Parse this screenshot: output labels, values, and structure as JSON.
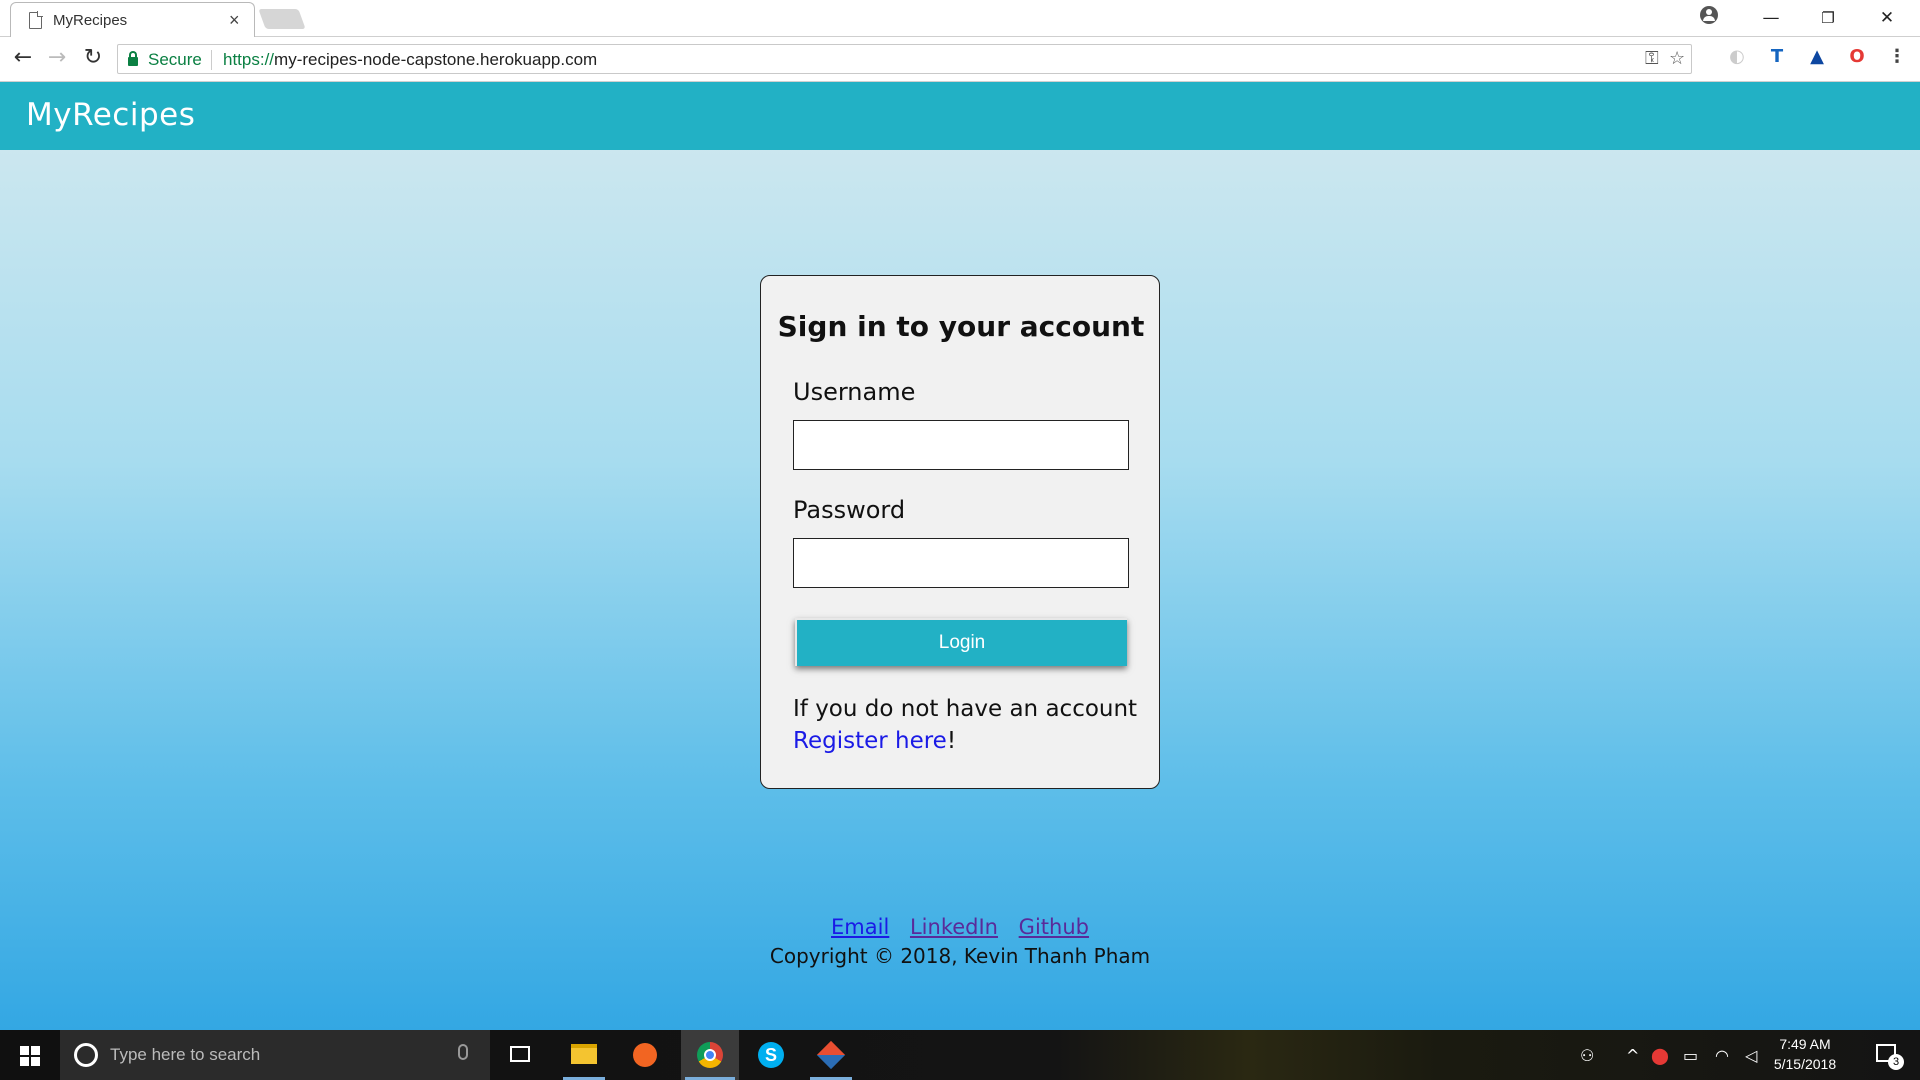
{
  "browser": {
    "tab_title": "MyRecipes",
    "tab_close": "×",
    "secure_label": "Secure",
    "url_scheme": "https://",
    "url_host": "my-recipes-node-capstone.herokuapp.com",
    "back_glyph": "←",
    "forward_glyph": "→",
    "reload_glyph": "↻",
    "minimize_glyph": "—",
    "restore_glyph": "❐",
    "close_glyph": "✕",
    "key_glyph": "⚿",
    "star_glyph": "☆",
    "menu_glyph": "⋮"
  },
  "header": {
    "site_title": "MyRecipes",
    "color": "#22b1c5"
  },
  "login": {
    "title": "Sign in to your account",
    "username_label": "Username",
    "username_value": "",
    "password_label": "Password",
    "password_value": "",
    "login_button": "Login",
    "no_account_text": "If you do not have an account",
    "register_link": "Register here",
    "register_suffix": "!"
  },
  "footer": {
    "links": [
      "Email",
      "LinkedIn",
      "Github"
    ],
    "copyright": "Copyright © 2018, Kevin Thanh Pham"
  },
  "taskbar": {
    "search_placeholder": "Type here to search",
    "time": "7:49 AM",
    "date": "5/15/2018",
    "notification_count": "3",
    "pinned_apps": [
      "task-view-icon",
      "file-explorer-icon",
      "pen-app-icon",
      "chrome-icon",
      "skype-icon",
      "git-icon"
    ]
  }
}
